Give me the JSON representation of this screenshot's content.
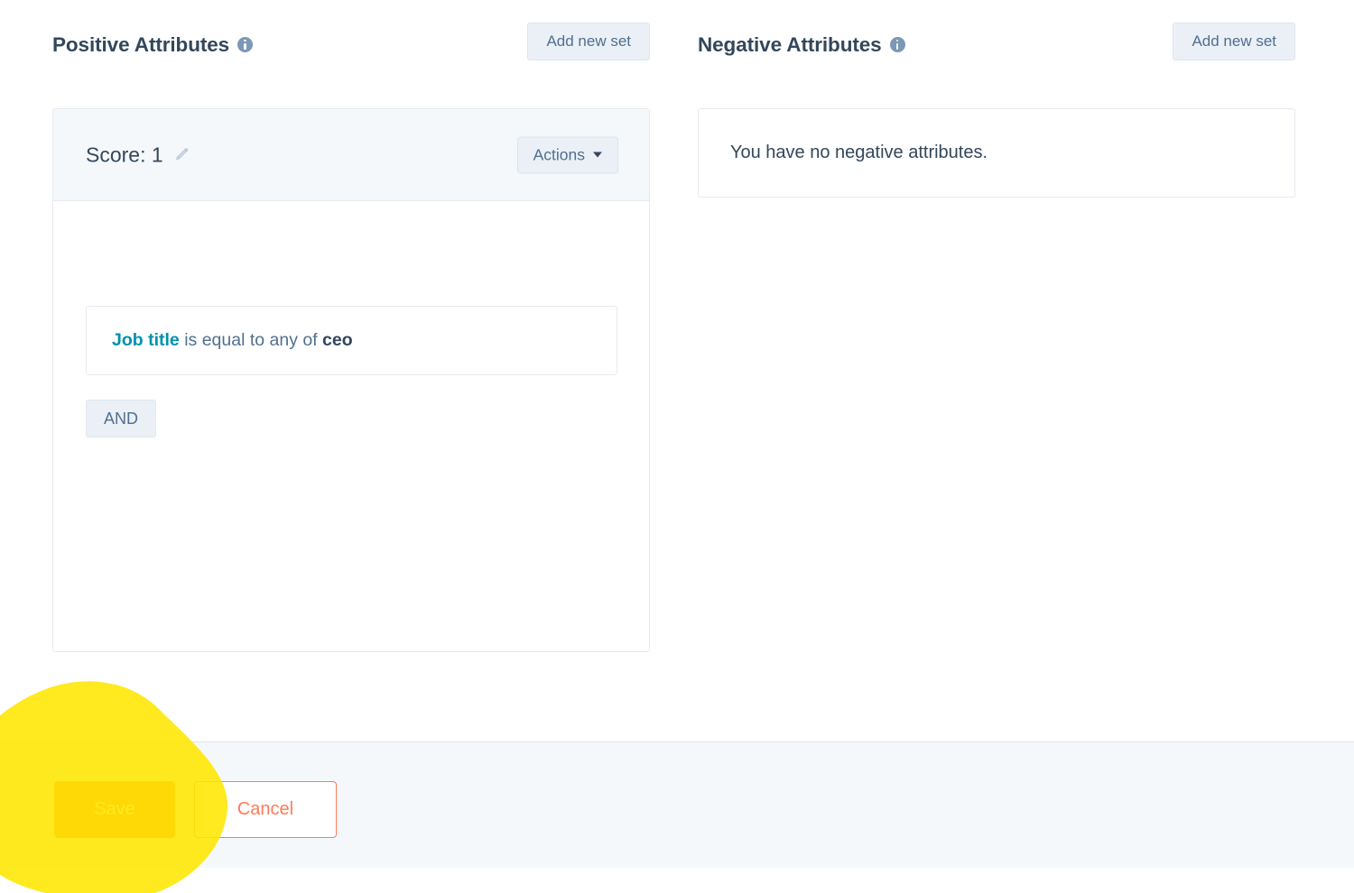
{
  "panels": {
    "positive": {
      "title": "Positive Attributes",
      "info_icon": "info-icon",
      "add_set_label": "Add new set",
      "card": {
        "score_label": "Score: 1",
        "edit_icon": "pencil-icon",
        "actions_label": "Actions",
        "caret_icon": "chevron-down-icon",
        "filter": {
          "property": "Job title",
          "operator": "is equal to any of",
          "value": "ceo"
        },
        "and_label": "AND"
      }
    },
    "negative": {
      "title": "Negative Attributes",
      "info_icon": "info-icon",
      "add_set_label": "Add new set",
      "empty_message": "You have no negative attributes."
    }
  },
  "footer": {
    "save_label": "Save",
    "cancel_label": "Cancel"
  },
  "annotation": {
    "type": "highlight-blob",
    "color": "#ffe600"
  },
  "colors": {
    "accent_teal": "#0091ae",
    "text_navy": "#33475b",
    "text_slate": "#516f90",
    "button_light": "#eaf0f6",
    "save_orange": "#ff7a2f",
    "cancel_orange": "#ff7a59",
    "panel_bg": "#f5f8fa",
    "border": "#e5eaf0",
    "highlight_yellow": "#ffe600"
  }
}
